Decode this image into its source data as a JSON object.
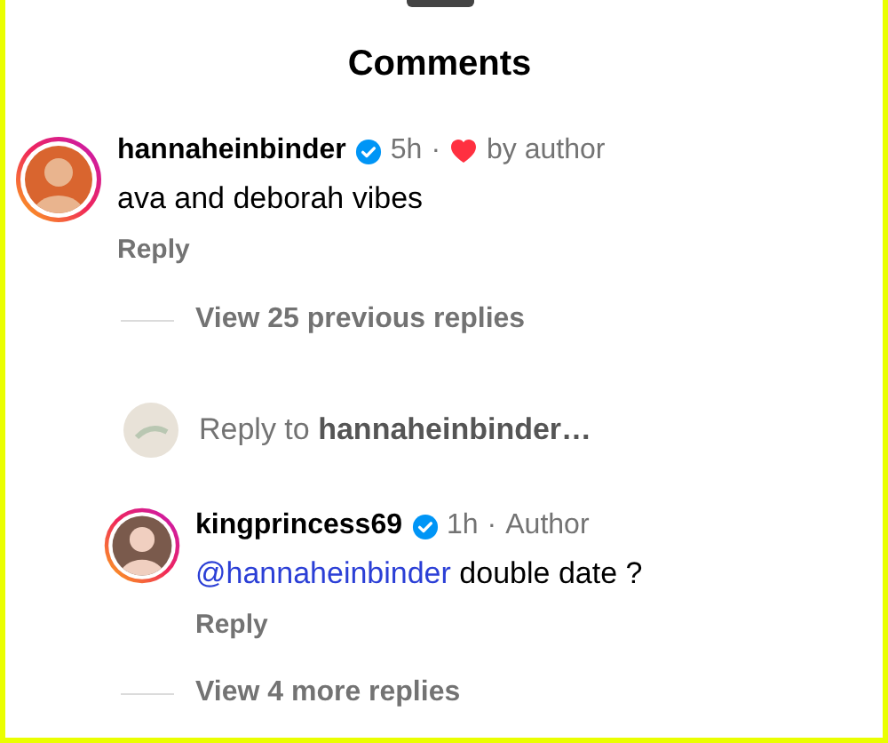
{
  "header": {
    "title": "Comments"
  },
  "thread": {
    "comment": {
      "username": "hannaheinbinder",
      "verified": true,
      "time": "5h",
      "separator": "·",
      "author_liked": true,
      "tag": "by author",
      "text": "ava and deborah vibes",
      "reply": "Reply"
    },
    "previous_replies": "View 25 previous replies",
    "reply_prompt": "Reply to **hannaheinbinder…**",
    "replies": [
      {
        "username": "kingprincess69",
        "verified": true,
        "time": "1h",
        "separator": "·",
        "tag": "Author",
        "mention": "@hannaheinbinder",
        "text": "double date ?",
        "reply": "Reply"
      }
    ],
    "more_replies": "View 4 more replies"
  }
}
